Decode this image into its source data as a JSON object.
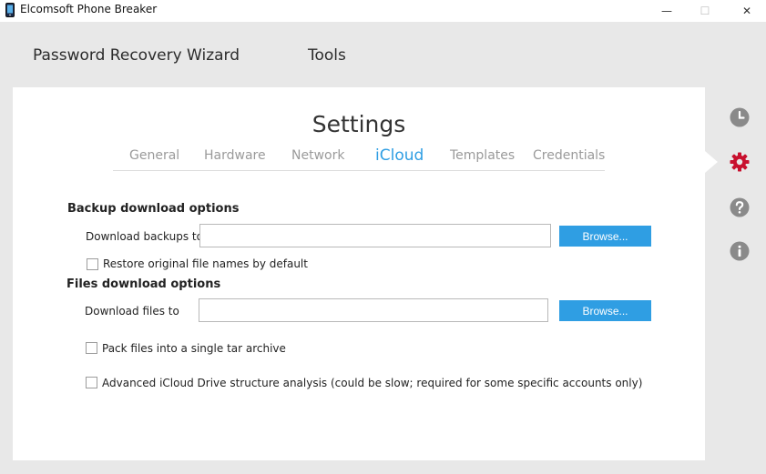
{
  "window": {
    "title": "Elcomsoft Phone Breaker",
    "minimize_glyph": "—",
    "maximize_glyph": "☐",
    "close_glyph": "✕"
  },
  "nav": {
    "wizard": "Password Recovery Wizard",
    "tools": "Tools"
  },
  "settings": {
    "title": "Settings",
    "tabs": [
      {
        "label": "General",
        "active": false
      },
      {
        "label": "Hardware",
        "active": false
      },
      {
        "label": "Network",
        "active": false
      },
      {
        "label": "iCloud",
        "active": true
      },
      {
        "label": "Templates",
        "active": false
      },
      {
        "label": "Credentials",
        "active": false
      }
    ]
  },
  "backup": {
    "section_title": "Backup download options",
    "download_label": "Download backups to",
    "download_value": "",
    "browse_label": "Browse...",
    "restore_label": "Restore original file names by default",
    "restore_checked": false
  },
  "files": {
    "section_title": "Files download options",
    "download_label": "Download files to",
    "download_value": "",
    "browse_label": "Browse...",
    "pack_label": "Pack files into a single tar archive",
    "pack_checked": false,
    "advanced_label": "Advanced iCloud Drive structure analysis (could be slow; required for some specific accounts only)",
    "advanced_checked": false
  },
  "sidebar": {
    "icons": [
      "history-icon",
      "settings-gear-icon",
      "help-icon",
      "info-icon"
    ],
    "active": "settings-gear-icon"
  },
  "colors": {
    "accent": "#2f9ee3",
    "active_gear": "#c8102e",
    "inactive_icon": "#8a8a8a",
    "background": "#e8e8e8"
  }
}
